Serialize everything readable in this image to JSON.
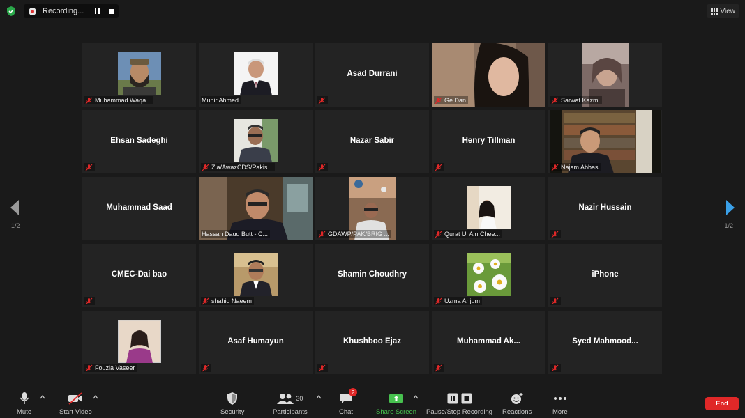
{
  "top_bar": {
    "recording_label": "Recording...",
    "view_label": "View"
  },
  "pager": {
    "left_page": "1/2",
    "right_page": "1/2"
  },
  "colors": {
    "active_speaker_border": "#c4d637",
    "share_screen": "#47c14f",
    "end_button": "#e02828",
    "mute_icon": "#e02828"
  },
  "tiles": [
    {
      "name": "Muhammad Waqa...",
      "type": "avatar"
    },
    {
      "name": "Munir Ahmed",
      "type": "avatar"
    },
    {
      "name": "Asad Durrani",
      "type": "name"
    },
    {
      "name": "Ge Dan",
      "type": "video"
    },
    {
      "name": "Sarwat Kazmi",
      "type": "video"
    },
    {
      "name": "Ehsan Sadeghi",
      "type": "name"
    },
    {
      "name": "Zia/AwazCDS/Pakis...",
      "type": "avatar"
    },
    {
      "name": "Nazar Sabir",
      "type": "name"
    },
    {
      "name": "Henry Tillman",
      "type": "name"
    },
    {
      "name": "Najam Abbas",
      "type": "video"
    },
    {
      "name": "Muhammad Saad",
      "type": "name"
    },
    {
      "name": "Hassan Daud Butt - C...",
      "type": "video",
      "active": true
    },
    {
      "name": "GDAWP/PAK/BRIG ...",
      "type": "avatar"
    },
    {
      "name": "Qurat Ul Ain Chee...",
      "type": "avatar"
    },
    {
      "name": "Nazir Hussain",
      "type": "name"
    },
    {
      "name": "CMEC-Dai bao",
      "type": "name"
    },
    {
      "name": "shahid Naeem",
      "type": "avatar"
    },
    {
      "name": "Shamin Choudhry",
      "type": "name"
    },
    {
      "name": "Uzma Anjum",
      "type": "avatar"
    },
    {
      "name": "iPhone",
      "type": "name"
    },
    {
      "name": "Fouzia Vaseer",
      "type": "avatar"
    },
    {
      "name": "Asaf Humayun",
      "type": "name"
    },
    {
      "name": "Khushboo Ejaz",
      "type": "name"
    },
    {
      "name": "Muhammad  Ak...",
      "type": "name"
    },
    {
      "name": "Syed  Mahmood...",
      "type": "name"
    }
  ],
  "toolbar": {
    "mute_label": "Mute",
    "start_video_label": "Start Video",
    "security_label": "Security",
    "participants_label": "Participants",
    "participants_count": "30",
    "chat_label": "Chat",
    "chat_badge": "2",
    "share_screen_label": "Share Screen",
    "pause_stop_recording_label": "Pause/Stop Recording",
    "reactions_label": "Reactions",
    "more_label": "More",
    "end_label": "End"
  }
}
